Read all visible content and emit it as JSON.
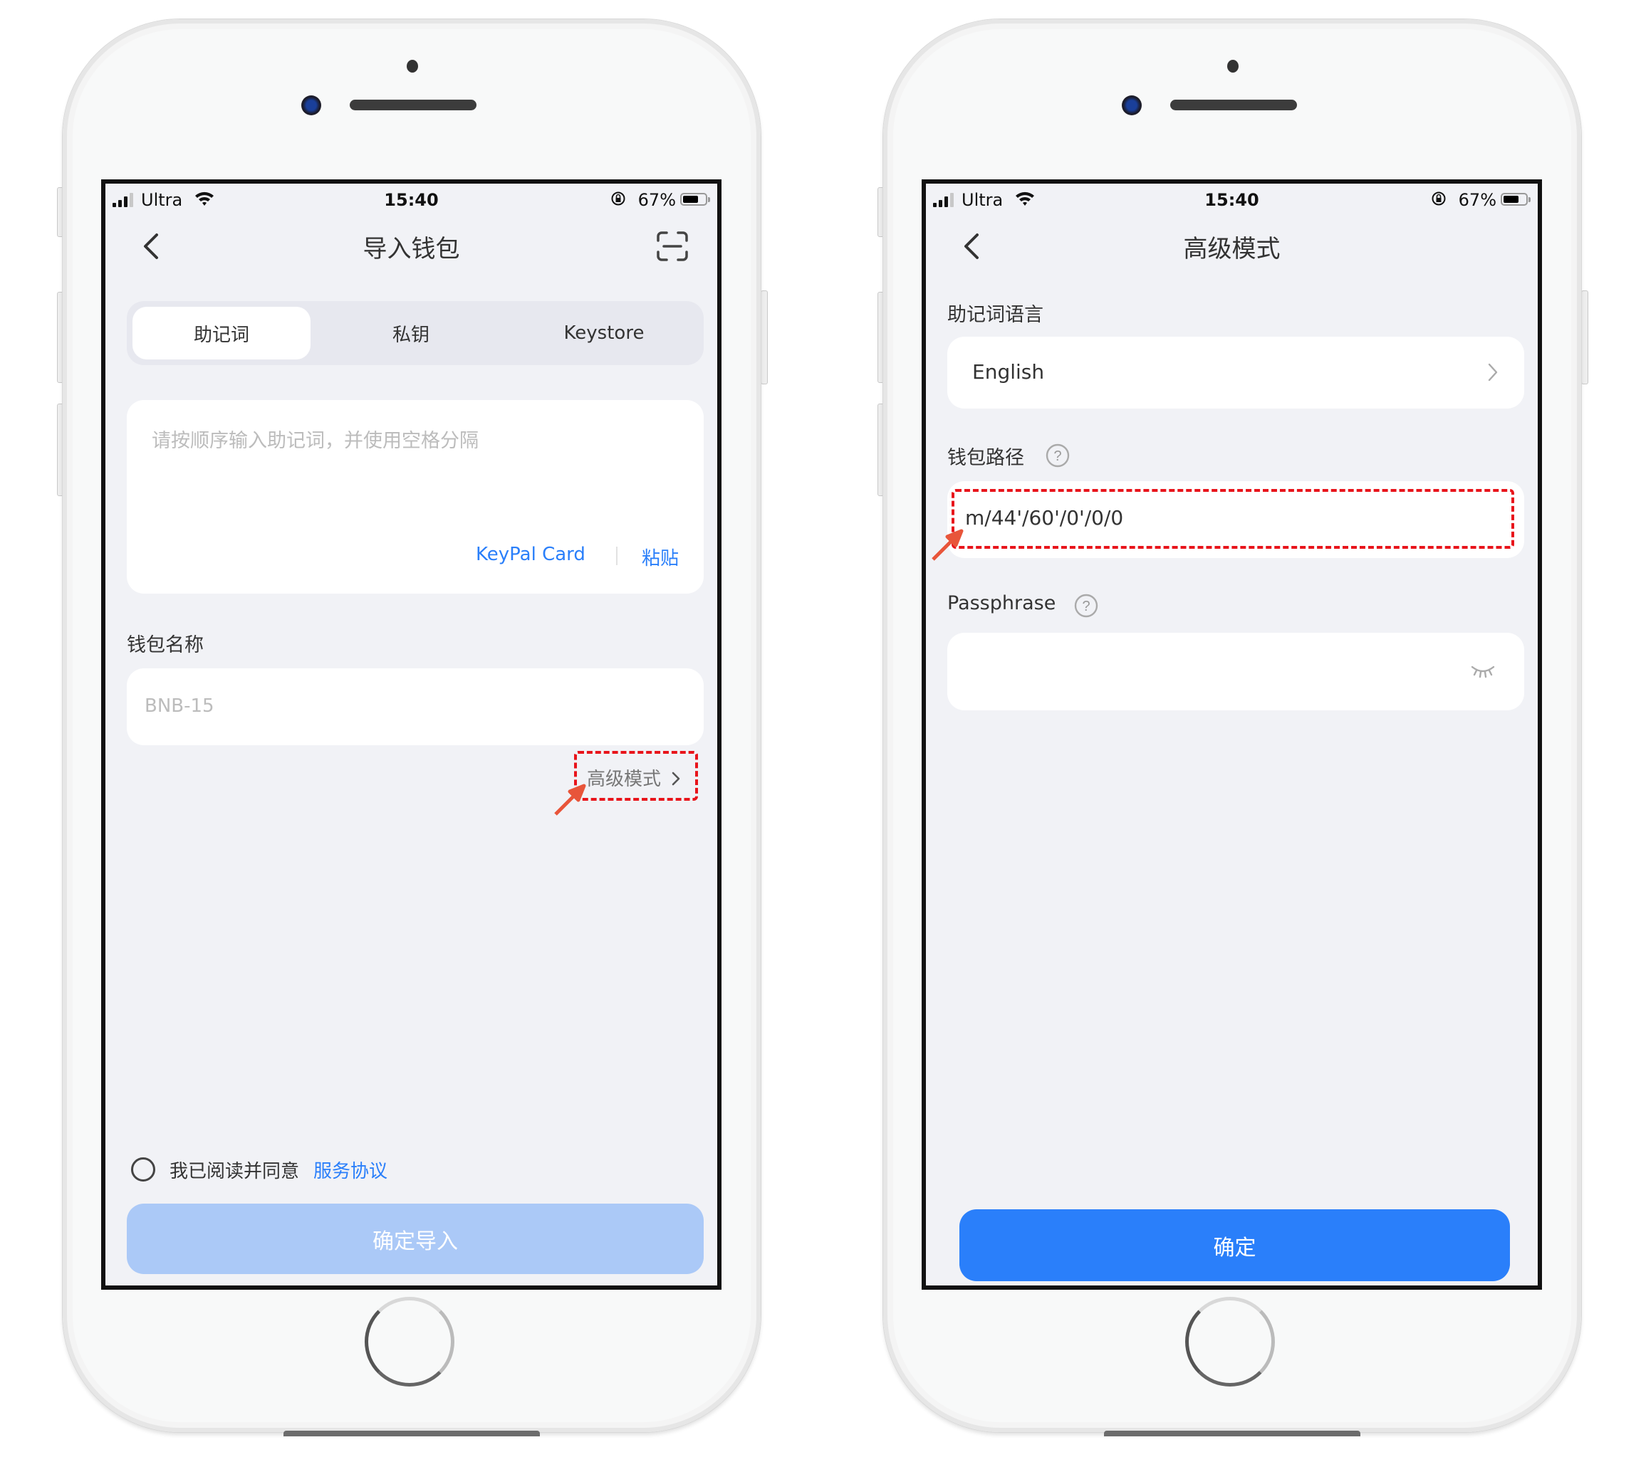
{
  "status_bar": {
    "carrier": "Ultra",
    "time": "15:40",
    "battery_percent": "67%",
    "battery_level": 0.67
  },
  "screen_left": {
    "title": "导入钱包",
    "icons": {
      "back": "chevron-left-icon",
      "scan": "scan-icon"
    },
    "tabs": [
      {
        "label": "助记词",
        "active": true
      },
      {
        "label": "私钥",
        "active": false
      },
      {
        "label": "Keystore",
        "active": false
      }
    ],
    "mnemonic_input": {
      "placeholder": "请按顺序输入助记词，并使用空格分隔",
      "value": ""
    },
    "keypal_card_link": "KeyPal Card",
    "paste_link": "粘贴",
    "wallet_name_label": "钱包名称",
    "wallet_name_input": {
      "placeholder": "BNB-15",
      "value": ""
    },
    "advanced_mode_link": "高级模式",
    "agreement": {
      "checked": false,
      "text": "我已阅读并同意",
      "link": "服务协议"
    },
    "confirm_button": {
      "label": "确定导入",
      "enabled": false
    }
  },
  "screen_right": {
    "title": "高级模式",
    "icons": {
      "back": "chevron-left-icon"
    },
    "mnemonic_language_label": "助记词语言",
    "mnemonic_language_value": "English",
    "wallet_path_label": "钱包路径",
    "wallet_path_value": "m/44'/60'/0'/0/0",
    "passphrase_label": "Passphrase",
    "passphrase_input": {
      "value": "",
      "masked": true
    },
    "confirm_button": {
      "label": "确定",
      "enabled": true
    }
  },
  "colors": {
    "accent": "#2a7ffa",
    "accent_disabled": "#abc9f7",
    "highlight_annotation": "#e8141b",
    "arrow_annotation": "#e8553a",
    "screen_bg": "#f1f2f6"
  }
}
